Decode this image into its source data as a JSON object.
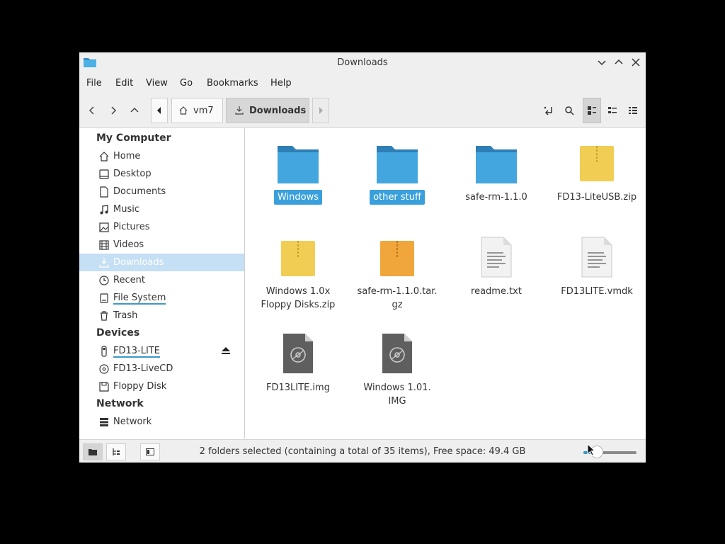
{
  "window": {
    "title": "Downloads"
  },
  "menu": {
    "file": "File",
    "edit": "Edit",
    "view": "View",
    "go": "Go",
    "bookmarks": "Bookmarks",
    "help": "Help"
  },
  "toolbar": {
    "breadcrumbs": [
      {
        "label": "vm7",
        "icon": "home-icon"
      },
      {
        "label": "Downloads",
        "icon": "download-icon"
      }
    ]
  },
  "sidebar": {
    "sections": [
      {
        "header": "My Computer",
        "items": [
          {
            "label": "Home",
            "icon": "home-icon"
          },
          {
            "label": "Desktop",
            "icon": "desktop-icon"
          },
          {
            "label": "Documents",
            "icon": "document-icon"
          },
          {
            "label": "Music",
            "icon": "music-icon"
          },
          {
            "label": "Pictures",
            "icon": "picture-icon"
          },
          {
            "label": "Videos",
            "icon": "video-icon"
          },
          {
            "label": "Downloads",
            "icon": "download-icon",
            "selected": true
          },
          {
            "label": "Recent",
            "icon": "clock-icon"
          },
          {
            "label": "File System",
            "icon": "drive-icon"
          },
          {
            "label": "Trash",
            "icon": "trash-icon"
          }
        ]
      },
      {
        "header": "Devices",
        "items": [
          {
            "label": "FD13-LITE",
            "icon": "usb-icon"
          },
          {
            "label": "FD13-LiveCD",
            "icon": "disc-icon"
          },
          {
            "label": "Floppy Disk",
            "icon": "floppy-icon"
          }
        ]
      },
      {
        "header": "Network",
        "items": [
          {
            "label": "Network",
            "icon": "network-icon"
          }
        ]
      }
    ]
  },
  "files": [
    {
      "name": "Windows",
      "type": "folder",
      "selected": true
    },
    {
      "name": "other stuff",
      "type": "folder",
      "selected": true
    },
    {
      "name": "safe-rm-1.1.0",
      "type": "folder",
      "selected": false
    },
    {
      "name": "FD13-LiteUSB.zip",
      "type": "zip",
      "selected": false
    },
    {
      "name": "Windows 1.0x\nFloppy Disks.zip",
      "type": "zip",
      "selected": false
    },
    {
      "name": "safe-rm-1.1.0.tar.\ngz",
      "type": "tar",
      "selected": false
    },
    {
      "name": "readme.txt",
      "type": "text",
      "selected": false
    },
    {
      "name": "FD13LITE.vmdk",
      "type": "text",
      "selected": false
    },
    {
      "name": "FD13LITE.img",
      "type": "image",
      "selected": false
    },
    {
      "name": "Windows 1.01.\nIMG",
      "type": "image",
      "selected": false
    }
  ],
  "status": {
    "text": "2 folders selected (containing a total of 35 items), Free space: 49.4 GB",
    "zoom": 0.25
  },
  "colors": {
    "accent": "#3aa0dc",
    "folder": "#3a8fc4",
    "zip": "#f1ce53",
    "tar": "#f0a63a",
    "sidebar_selected": "#c5dff4"
  }
}
